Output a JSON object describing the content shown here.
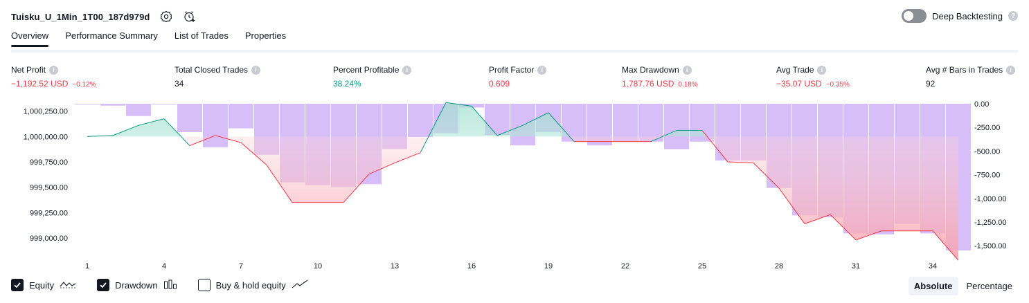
{
  "header": {
    "strategy_name": "Tuisku_U_1Min_1T00_187d979d",
    "settings_icon": "settings-gear-icon",
    "add_alert_icon": "alert-clock-icon"
  },
  "deep_backtesting": {
    "label": "Deep Backtesting",
    "enabled": false,
    "help": "?"
  },
  "tabs": [
    {
      "label": "Overview",
      "active": true
    },
    {
      "label": "Performance Summary",
      "active": false
    },
    {
      "label": "List of Trades",
      "active": false
    },
    {
      "label": "Properties",
      "active": false
    }
  ],
  "metrics": {
    "net_profit": {
      "label": "Net Profit",
      "value": "−1,192.52 USD",
      "pct": "−0.12%"
    },
    "total_closed_trades": {
      "label": "Total Closed Trades",
      "value": "34"
    },
    "percent_profitable": {
      "label": "Percent Profitable",
      "value": "38.24%"
    },
    "profit_factor": {
      "label": "Profit Factor",
      "value": "0.609"
    },
    "max_drawdown": {
      "label": "Max Drawdown",
      "value": "1,787.76 USD",
      "pct": "0.18%"
    },
    "avg_trade": {
      "label": "Avg Trade",
      "value": "−35.07 USD",
      "pct": "−0.35%"
    },
    "avg_bars": {
      "label": "Avg # Bars in Trades",
      "value": "92"
    }
  },
  "chart_data": {
    "type": "line",
    "x_tick_labels": [
      "1",
      "4",
      "7",
      "10",
      "13",
      "16",
      "19",
      "22",
      "25",
      "28",
      "31",
      "34"
    ],
    "left_axis": {
      "label": "Equity",
      "ylim": [
        998850,
        1000350
      ],
      "ticks": [
        "1,000,250.00",
        "1,000,000.00",
        "999,750.00",
        "999,500.00",
        "999,250.00",
        "999,000.00"
      ]
    },
    "right_axis": {
      "label": "Drawdown",
      "ylim": [
        -1550,
        0
      ],
      "ticks": [
        "0.00",
        "-250.00",
        "-500.00",
        "-750.00",
        "-1,000.00",
        "-1,250.00",
        "-1,500.00"
      ]
    },
    "equity": {
      "x": [
        1,
        2,
        3,
        4,
        5,
        6,
        7,
        8,
        9,
        10,
        11,
        12,
        13,
        14,
        15,
        16,
        17,
        18,
        19,
        20,
        21,
        22,
        23,
        24,
        25,
        26,
        27,
        28,
        29,
        30,
        31,
        32,
        33,
        34,
        35
      ],
      "y": [
        1000000,
        1000010,
        1000110,
        1000175,
        999910,
        1000010,
        999940,
        999720,
        999350,
        999350,
        999350,
        999630,
        999740,
        999840,
        1000335,
        1000300,
        1000010,
        1000110,
        1000235,
        999950,
        999950,
        999950,
        999950,
        1000060,
        1000060,
        999750,
        999740,
        999490,
        999140,
        999230,
        998980,
        999070,
        999070,
        999070,
        998780
      ]
    },
    "drawdown": {
      "x": [
        1,
        2,
        3,
        4,
        5,
        6,
        7,
        8,
        9,
        10,
        11,
        12,
        13,
        14,
        15,
        16,
        17,
        18,
        19,
        20,
        21,
        22,
        23,
        24,
        25,
        26,
        27,
        28,
        29,
        30,
        31,
        32,
        33,
        34,
        35
      ],
      "y": [
        -5,
        -20,
        -130,
        0,
        -300,
        -460,
        -260,
        -540,
        -830,
        -860,
        -880,
        -850,
        -480,
        -350,
        -310,
        -40,
        -330,
        -440,
        -300,
        -400,
        -440,
        -400,
        -400,
        -480,
        -400,
        -600,
        -600,
        -890,
        -1180,
        -1200,
        -1370,
        -1380,
        -1270,
        -1370,
        -1550
      ]
    },
    "colors": {
      "equity_profit": "#089981",
      "equity_loss": "#f23645",
      "drawdown_bar": "#d1b3f7",
      "equity_fill_profit": "#e0f3ee",
      "equity_fill_loss": "#fde0e3"
    }
  },
  "legend": {
    "equity": {
      "label": "Equity",
      "checked": true
    },
    "drawdown": {
      "label": "Drawdown",
      "checked": true
    },
    "buy_hold": {
      "label": "Buy & hold equity",
      "checked": false
    }
  },
  "scale": {
    "absolute": "Absolute",
    "percentage": "Percentage",
    "active": "absolute"
  }
}
